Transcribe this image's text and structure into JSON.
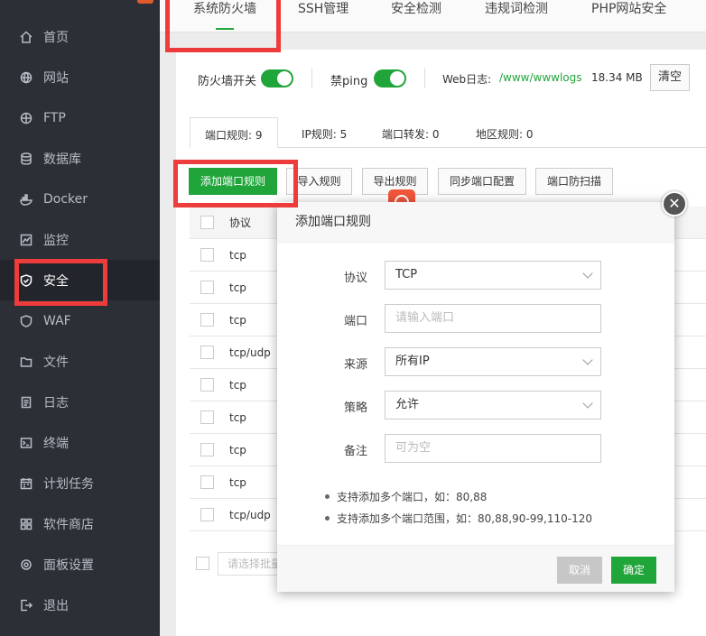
{
  "sidebar": {
    "items": [
      {
        "label": "首页",
        "icon": "home-icon"
      },
      {
        "label": "网站",
        "icon": "globe-icon"
      },
      {
        "label": "FTP",
        "icon": "globe-icon"
      },
      {
        "label": "数据库",
        "icon": "database-icon"
      },
      {
        "label": "Docker",
        "icon": "docker-icon"
      },
      {
        "label": "监控",
        "icon": "monitor-icon"
      },
      {
        "label": "安全",
        "icon": "shield-icon"
      },
      {
        "label": "WAF",
        "icon": "waf-icon"
      },
      {
        "label": "文件",
        "icon": "folder-icon"
      },
      {
        "label": "日志",
        "icon": "log-icon"
      },
      {
        "label": "终端",
        "icon": "terminal-icon"
      },
      {
        "label": "计划任务",
        "icon": "calendar-icon"
      },
      {
        "label": "软件商店",
        "icon": "grid-icon"
      },
      {
        "label": "面板设置",
        "icon": "gear-icon"
      },
      {
        "label": "退出",
        "icon": "logout-icon"
      }
    ]
  },
  "tabs": [
    "系统防火墙",
    "SSH管理",
    "安全检测",
    "违规词检测",
    "PHP网站安全"
  ],
  "toolbar": {
    "firewall_label": "防火墙开关",
    "ping_label": "禁ping",
    "weblog_label": "Web日志:",
    "weblog_path": "/www/wwwlogs",
    "weblog_size": "18.34 MB",
    "clear_label": "清空"
  },
  "subtabs": [
    "端口规则: 9",
    "IP规则: 5",
    "端口转发: 0",
    "地区规则: 0"
  ],
  "actions": [
    "添加端口规则",
    "导入规则",
    "导出规则",
    "同步端口配置",
    "端口防扫描"
  ],
  "table": {
    "header": "协议",
    "rows": [
      "tcp",
      "tcp",
      "tcp",
      "tcp/udp",
      "tcp",
      "tcp",
      "tcp",
      "tcp",
      "tcp/udp"
    ]
  },
  "footer": {
    "batch_placeholder": "请选择批量"
  },
  "modal": {
    "title": "添加端口规则",
    "fields": [
      {
        "label": "协议",
        "value": "TCP",
        "type": "select"
      },
      {
        "label": "端口",
        "placeholder": "请输入端口",
        "type": "input"
      },
      {
        "label": "来源",
        "value": "所有IP",
        "type": "select"
      },
      {
        "label": "策略",
        "value": "允许",
        "type": "select"
      },
      {
        "label": "备注",
        "placeholder": "可为空",
        "type": "input"
      }
    ],
    "tips": [
      "支持添加多个端口，如：80,88",
      "支持添加多个端口范围，如：80,88,90-99,110-120"
    ],
    "cancel": "取消",
    "confirm": "确定",
    "close": "✕"
  },
  "colors": {
    "accent": "#20a53a",
    "highlight": "#ee3b3b",
    "sidebar_bg": "#2c2f36"
  }
}
